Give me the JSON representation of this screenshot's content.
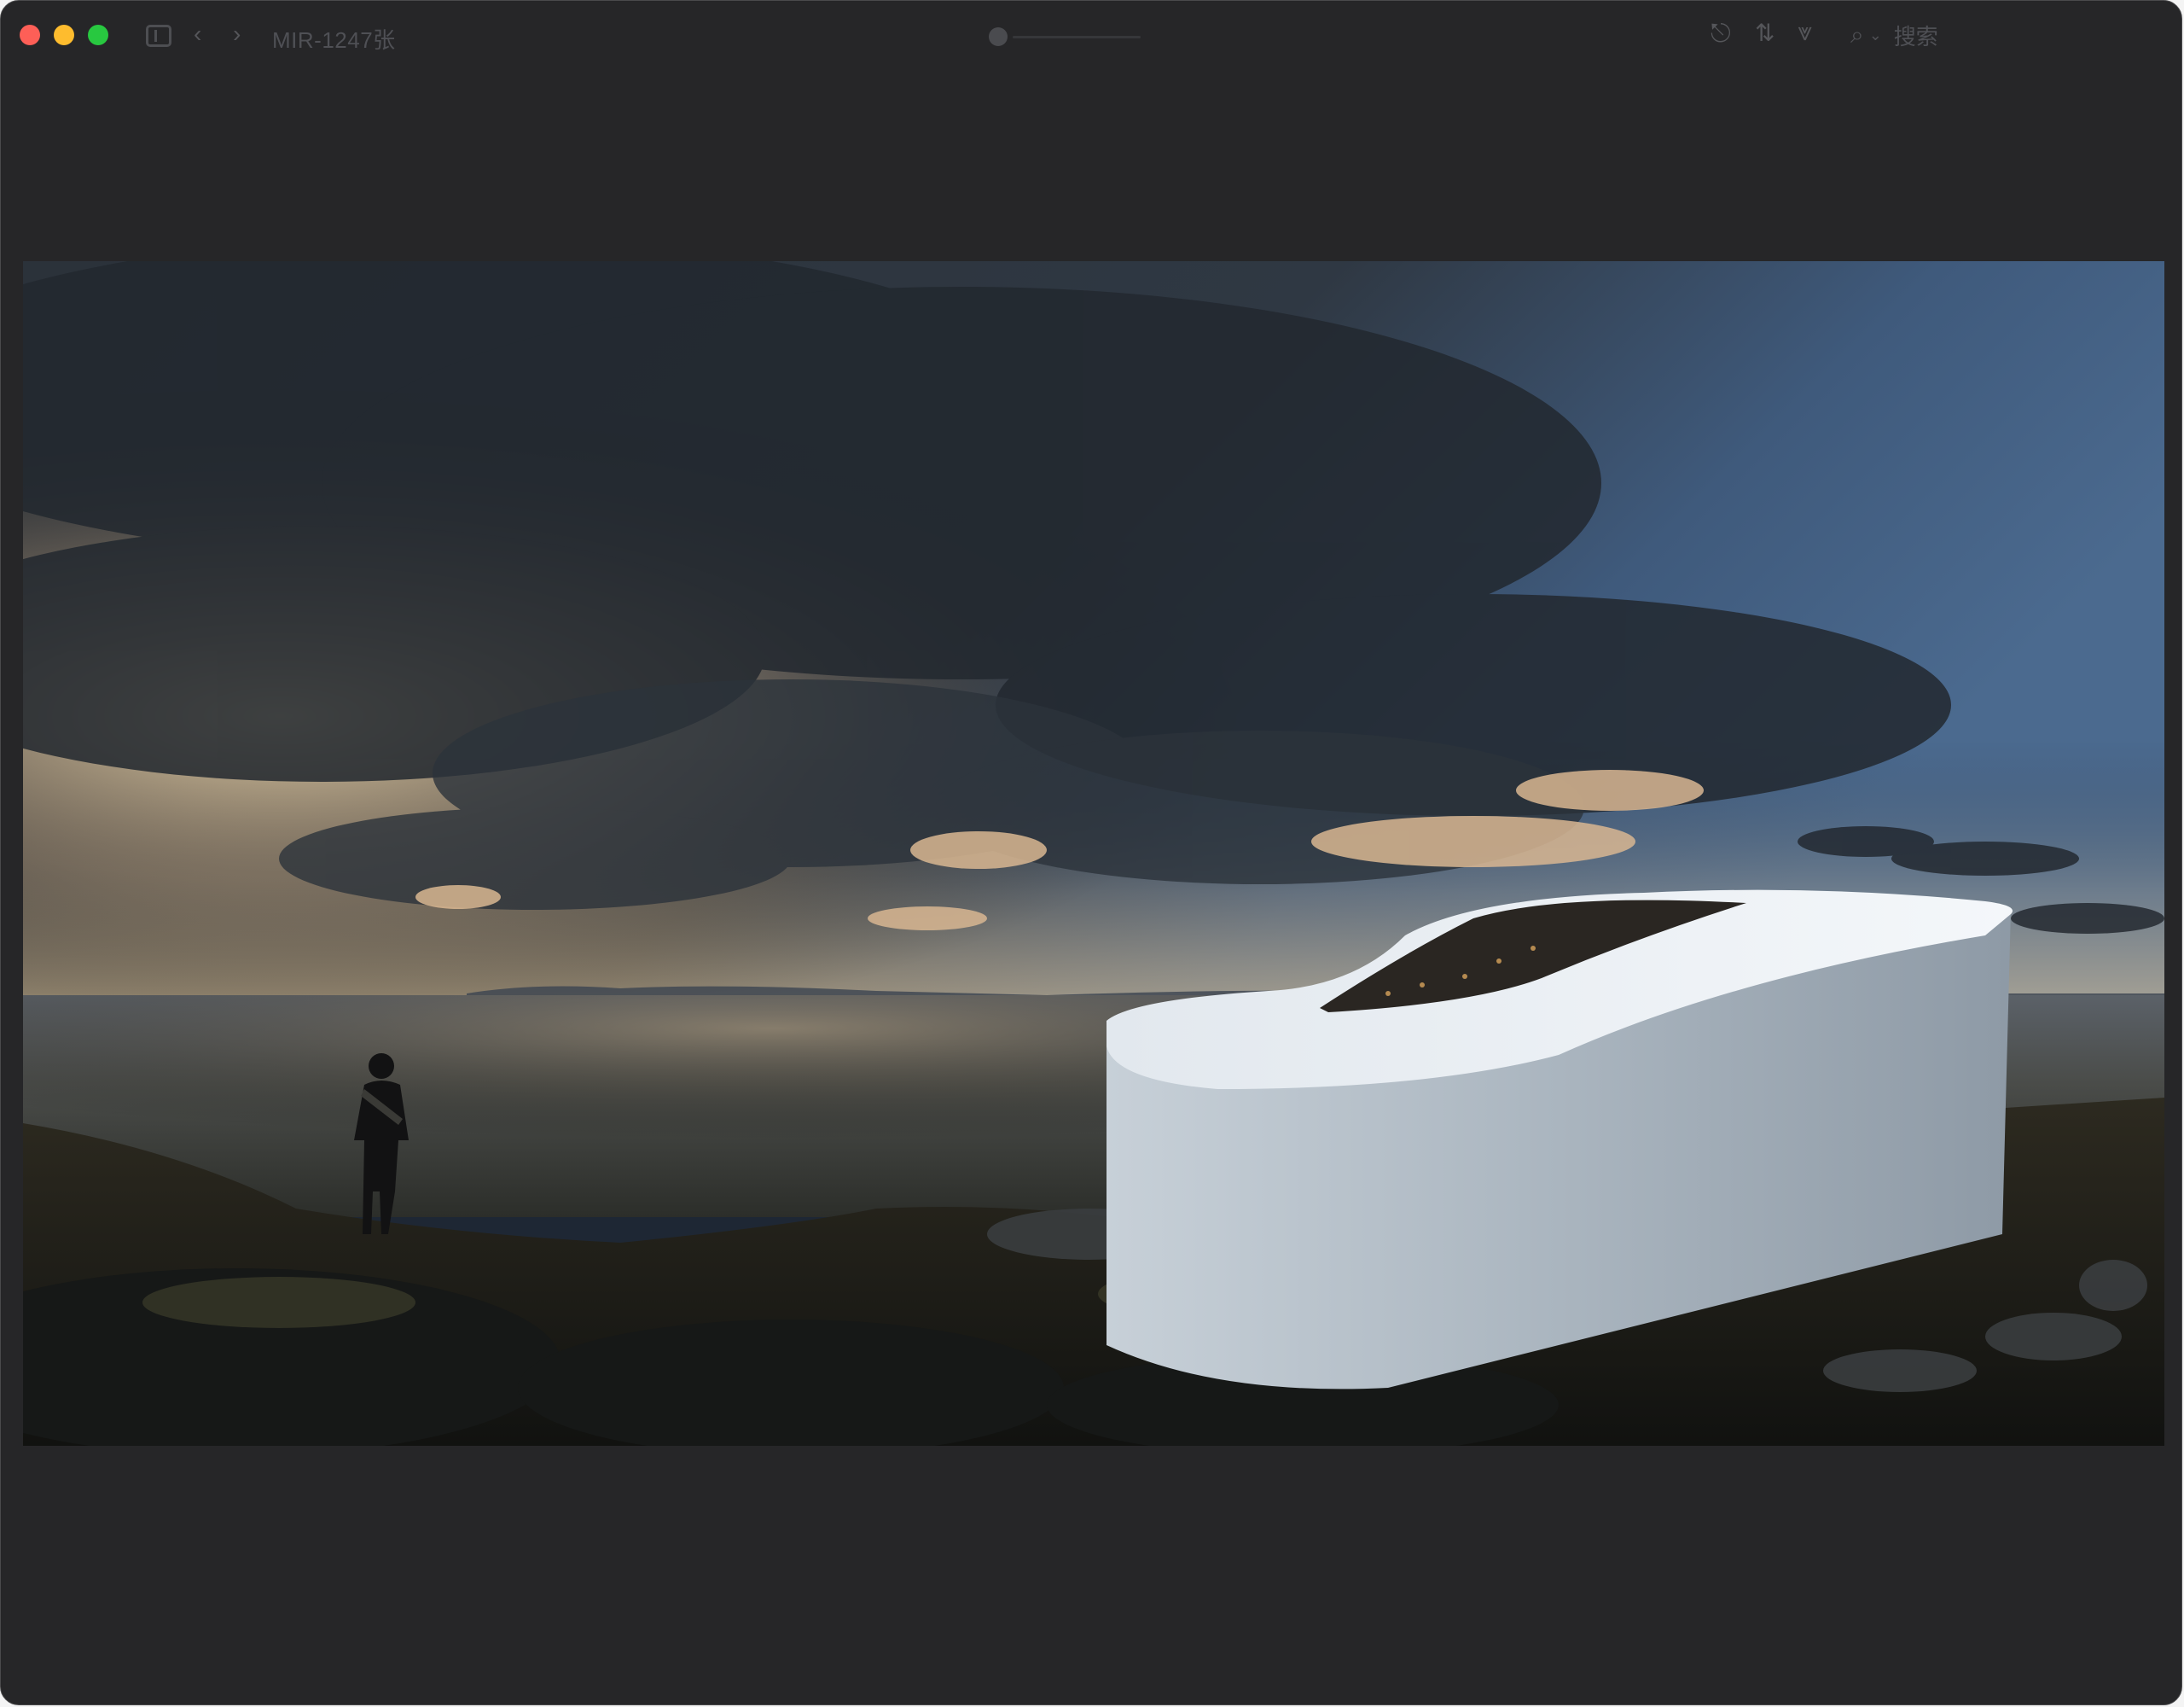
{
  "window": {
    "title": "MIR-1247张",
    "controls": [
      "close",
      "minimize",
      "zoom"
    ]
  },
  "toolbar": {
    "icons": {
      "sidebar": "sidebar-toggle-icon",
      "back": "chevron-left-icon",
      "forward": "chevron-right-icon",
      "share": "share-icon",
      "sort": "sort-icon",
      "filter": "filter-icon",
      "search": "search-icon"
    },
    "search_placeholder": "搜索"
  },
  "colors": {
    "window_bg": "#262628",
    "close": "#fe5f57",
    "minimize": "#febc2e",
    "zoom": "#28c840",
    "sky_dark": "#2a313b",
    "sky_blue": "#3e587a",
    "horizon_glow": "#e9c48e",
    "sea": "#4a4c4a",
    "building": "#c8d2dc",
    "rock": "#1a1c1e"
  },
  "viewer": {
    "image_subject": "architecture-render-coastal-building"
  }
}
